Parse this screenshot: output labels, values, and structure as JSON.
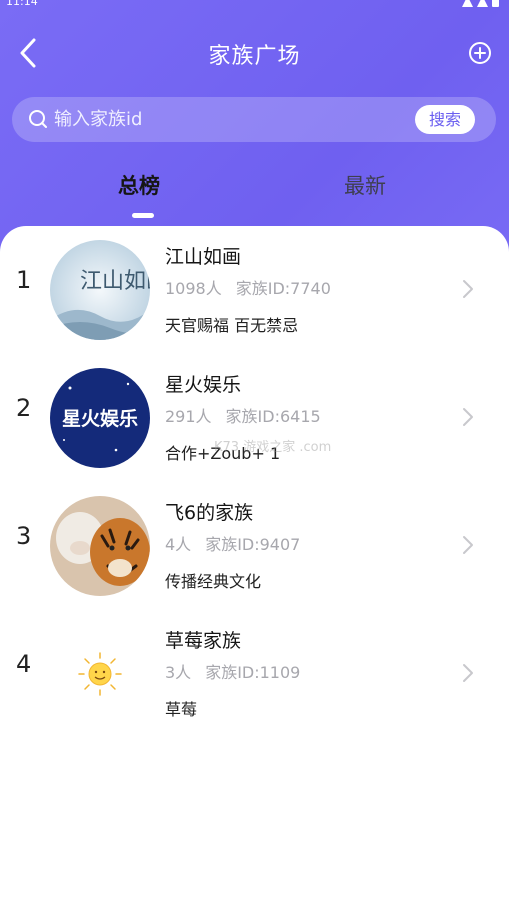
{
  "status_bar": {
    "time": "11:14"
  },
  "header": {
    "title": "家族广场"
  },
  "search": {
    "placeholder": "输入家族id",
    "button_label": "搜索"
  },
  "tabs": [
    {
      "label": "总榜",
      "active": true
    },
    {
      "label": "最新",
      "active": false
    }
  ],
  "families": [
    {
      "rank": "1",
      "name": "江山如画",
      "members": "1098人",
      "family_id": "家族ID:7740",
      "description": "天官赐福 百无禁忌",
      "avatar_text": "江山如画"
    },
    {
      "rank": "2",
      "name": "星火娱乐",
      "members": "291人",
      "family_id": "家族ID:6415",
      "description": "合作+Zoub+ 1",
      "avatar_text": "星火娱乐"
    },
    {
      "rank": "3",
      "name": "飞6的家族",
      "members": "4人",
      "family_id": "家族ID:9407",
      "description": "传播经典文化",
      "avatar_text": ""
    },
    {
      "rank": "4",
      "name": "草莓家族",
      "members": "3人",
      "family_id": "家族ID:1109",
      "description": "草莓",
      "avatar_text": ""
    }
  ],
  "watermark": "K73 游戏之家 .com",
  "colors": {
    "header_gradient_start": "#7a6cf5",
    "header_gradient_end": "#8f84ff",
    "accent": "#6a5ef0"
  }
}
